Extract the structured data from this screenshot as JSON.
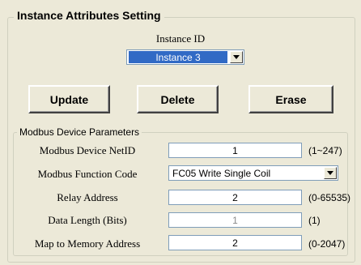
{
  "group": {
    "title": "Instance Attributes Setting"
  },
  "instance": {
    "label": "Instance ID",
    "selected": "Instance  3"
  },
  "buttons": {
    "update": "Update",
    "delete": "Delete",
    "erase": "Erase"
  },
  "modbus": {
    "title": "Modbus Device Parameters",
    "rows": [
      {
        "label": "Modbus Device NetID",
        "value": "1",
        "range": "(1~247)"
      },
      {
        "label": "Modbus Function Code",
        "value": "FC05 Write Single Coil"
      },
      {
        "label": "Relay Address",
        "value": "2",
        "range": "(0-65535)"
      },
      {
        "label": "Data Length (Bits)",
        "value": "1",
        "range": "(1)"
      },
      {
        "label": "Map to Memory Address",
        "value": "2",
        "range": "(0-2047)"
      }
    ]
  }
}
